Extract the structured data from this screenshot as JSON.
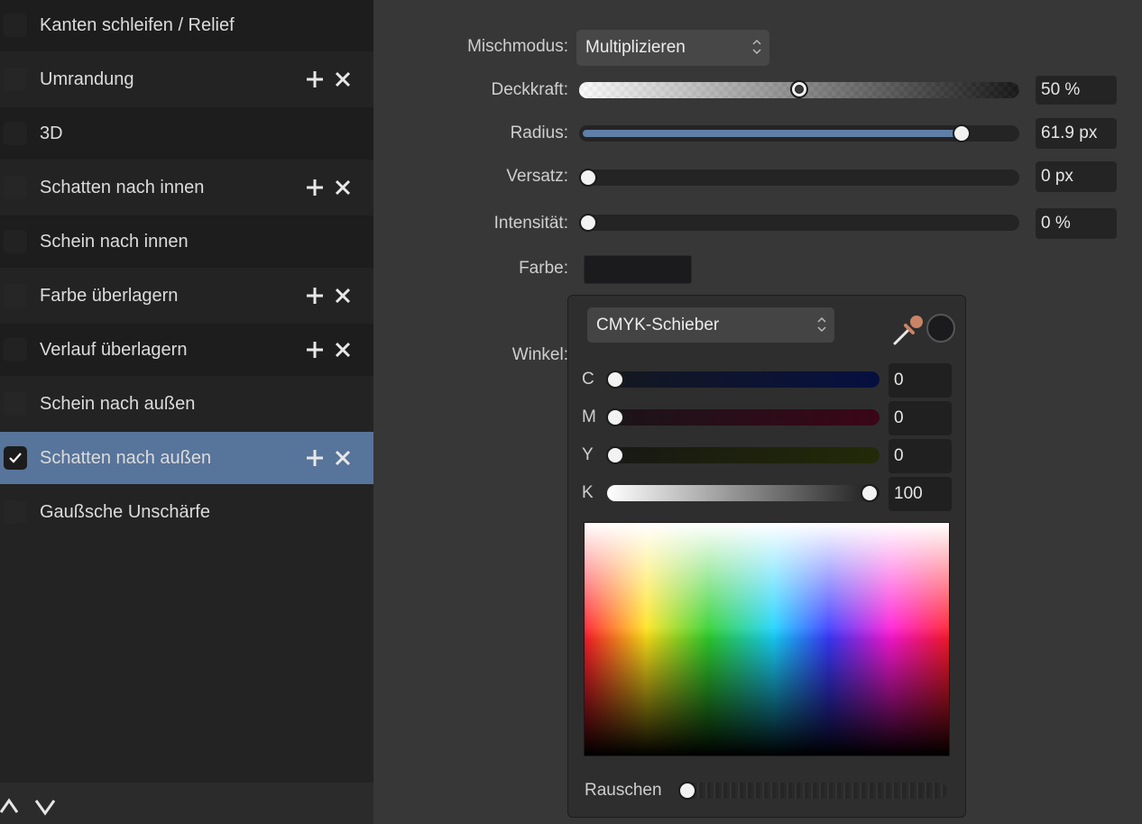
{
  "effects": [
    {
      "label": "Kanten schleifen / Relief",
      "checked": false,
      "edit_buttons": false
    },
    {
      "label": "Umrandung",
      "checked": false,
      "edit_buttons": true
    },
    {
      "label": "3D",
      "checked": false,
      "edit_buttons": false
    },
    {
      "label": "Schatten nach innen",
      "checked": false,
      "edit_buttons": true
    },
    {
      "label": "Schein nach innen",
      "checked": false,
      "edit_buttons": false
    },
    {
      "label": "Farbe überlagern",
      "checked": false,
      "edit_buttons": true
    },
    {
      "label": "Verlauf überlagern",
      "checked": false,
      "edit_buttons": true
    },
    {
      "label": "Schein nach außen",
      "checked": false,
      "edit_buttons": false
    },
    {
      "label": "Schatten nach außen",
      "checked": true,
      "edit_buttons": true,
      "selected": true
    },
    {
      "label": "Gaußsche Unschärfe",
      "checked": false,
      "edit_buttons": false
    }
  ],
  "properties": {
    "blend_mode": {
      "label": "Mischmodus:",
      "value": "Multiplizieren"
    },
    "opacity": {
      "label": "Deckkraft:",
      "value": "50 %",
      "fraction": 0.5
    },
    "radius": {
      "label": "Radius:",
      "value": "61.9 px",
      "fraction": 0.885
    },
    "offset": {
      "label": "Versatz:",
      "value": "0 px",
      "fraction": 0
    },
    "intensity": {
      "label": "Intensität:",
      "value": "0 %",
      "fraction": 0
    },
    "color": {
      "label": "Farbe:",
      "value_color": "#1b1a1d"
    },
    "angle": {
      "label": "Winkel:"
    }
  },
  "color_picker": {
    "model": "CMYK-Schieber",
    "current_color": "#1b1a1d",
    "channels": [
      {
        "label": "C",
        "value": "0",
        "fraction": 0
      },
      {
        "label": "M",
        "value": "0",
        "fraction": 0
      },
      {
        "label": "Y",
        "value": "0",
        "fraction": 0
      },
      {
        "label": "K",
        "value": "100",
        "fraction": 1
      }
    ],
    "noise": {
      "label": "Rauschen",
      "fraction": 0
    }
  },
  "colors": {
    "selected_row": "#57749a",
    "radius_fill": "#5f7fa8"
  }
}
